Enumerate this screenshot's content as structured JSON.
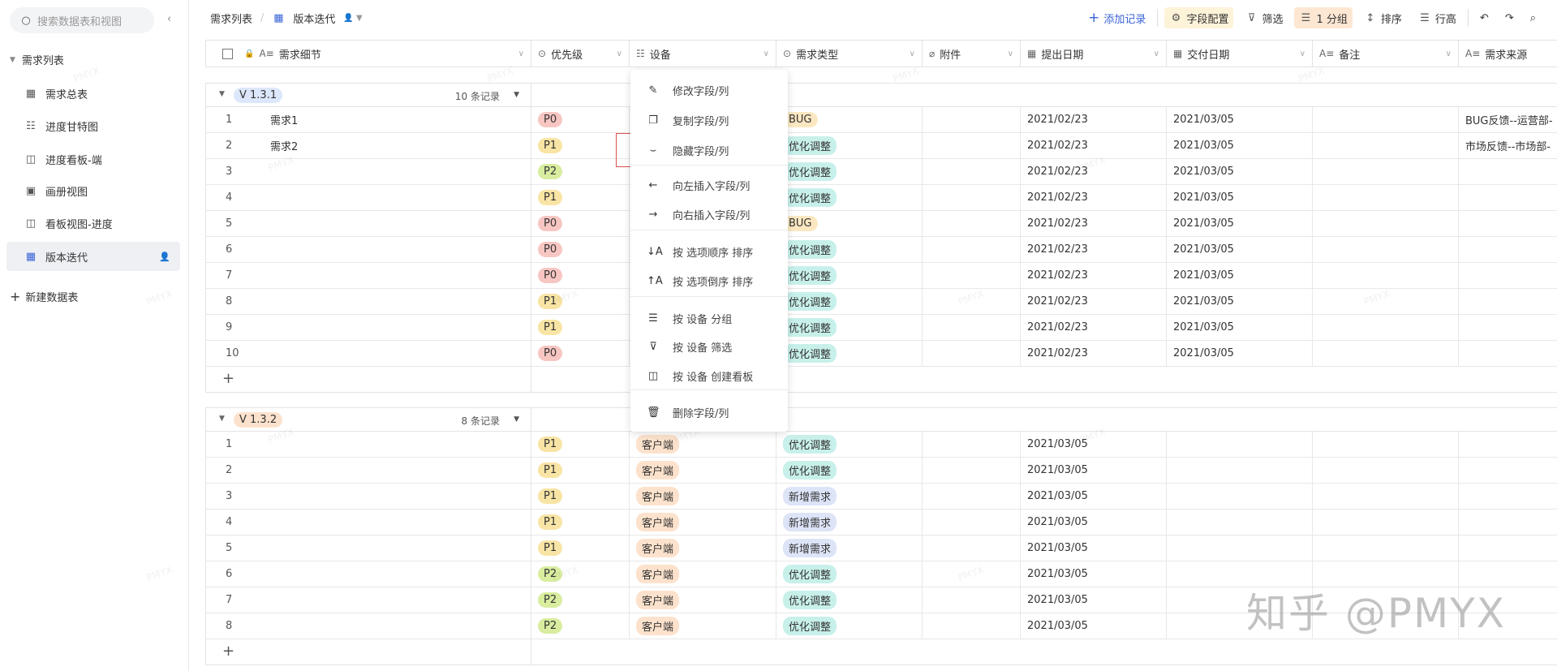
{
  "sidebar": {
    "search_placeholder": "搜索数据表和视图",
    "root": "需求列表",
    "items": [
      {
        "label": "需求总表",
        "icon": "grid"
      },
      {
        "label": "进度甘特图",
        "icon": "gantt"
      },
      {
        "label": "进度看板-端",
        "icon": "kanban"
      },
      {
        "label": "画册视图",
        "icon": "gallery"
      },
      {
        "label": "看板视图-进度",
        "icon": "kanban"
      },
      {
        "label": "版本迭代",
        "icon": "grid",
        "active": true
      }
    ],
    "new_table": "新建数据表"
  },
  "topbar": {
    "crumb_root": "需求列表",
    "crumb_view": "版本迭代",
    "add_record": "添加记录",
    "field_config": "字段配置",
    "filter": "筛选",
    "group": "1 分组",
    "sort": "排序",
    "row_height": "行高"
  },
  "columns": [
    {
      "label": "需求细节",
      "icon": "A≡"
    },
    {
      "label": "优先级",
      "icon": "⊙"
    },
    {
      "label": "设备",
      "icon": "☷"
    },
    {
      "label": "需求类型",
      "icon": "⊙"
    },
    {
      "label": "附件",
      "icon": "⌀"
    },
    {
      "label": "提出日期",
      "icon": "▦"
    },
    {
      "label": "交付日期",
      "icon": "▦"
    },
    {
      "label": "备注",
      "icon": "A≡"
    },
    {
      "label": "需求来源",
      "icon": "A≡"
    }
  ],
  "colors": {
    "P0": "#f7c6c2",
    "P1": "#f8e4a4",
    "P2": "#d8ed9f",
    "BUG": "#fbe8c2",
    "优化调整": "#c8f0eb",
    "新增需求": "#dde4f7",
    "客户端": "#fce2cc",
    "accent": "#3a63d6"
  },
  "groups": [
    {
      "version": "V 1.3.1",
      "count": "10 条记录",
      "rows": [
        {
          "n": "1",
          "detail": "需求1",
          "pri": "P0",
          "device": "",
          "type": "BUG",
          "d1": "2021/02/23",
          "d2": "2021/03/05",
          "src": "BUG反馈--运营部-"
        },
        {
          "n": "2",
          "detail": "需求2",
          "pri": "P1",
          "device": "",
          "type": "优化调整",
          "d1": "2021/02/23",
          "d2": "2021/03/05",
          "src": "市场反馈--市场部-"
        },
        {
          "n": "3",
          "detail": "",
          "pri": "P2",
          "device": "",
          "type": "优化调整",
          "d1": "2021/02/23",
          "d2": "2021/03/05",
          "src": ""
        },
        {
          "n": "4",
          "detail": "",
          "pri": "P1",
          "device": "",
          "type": "优化调整",
          "d1": "2021/02/23",
          "d2": "2021/03/05",
          "src": ""
        },
        {
          "n": "5",
          "detail": "",
          "pri": "P0",
          "device": "",
          "type": "BUG",
          "d1": "2021/02/23",
          "d2": "2021/03/05",
          "src": ""
        },
        {
          "n": "6",
          "detail": "",
          "pri": "P0",
          "device": "",
          "type": "优化调整",
          "d1": "2021/02/23",
          "d2": "2021/03/05",
          "src": ""
        },
        {
          "n": "7",
          "detail": "",
          "pri": "P0",
          "device": "",
          "type": "优化调整",
          "d1": "2021/02/23",
          "d2": "2021/03/05",
          "src": ""
        },
        {
          "n": "8",
          "detail": "",
          "pri": "P1",
          "device": "",
          "type": "优化调整",
          "d1": "2021/02/23",
          "d2": "2021/03/05",
          "src": ""
        },
        {
          "n": "9",
          "detail": "",
          "pri": "P1",
          "device": "",
          "type": "优化调整",
          "d1": "2021/02/23",
          "d2": "2021/03/05",
          "src": ""
        },
        {
          "n": "10",
          "detail": "",
          "pri": "P0",
          "device": "",
          "type": "优化调整",
          "d1": "2021/02/23",
          "d2": "2021/03/05",
          "src": ""
        }
      ]
    },
    {
      "version": "V 1.3.2",
      "count": "8 条记录",
      "rows": [
        {
          "n": "1",
          "detail": "",
          "pri": "P1",
          "device": "客户端",
          "type": "优化调整",
          "d1": "2021/03/05",
          "d2": "",
          "src": ""
        },
        {
          "n": "2",
          "detail": "",
          "pri": "P1",
          "device": "客户端",
          "type": "优化调整",
          "d1": "2021/03/05",
          "d2": "",
          "src": ""
        },
        {
          "n": "3",
          "detail": "",
          "pri": "P1",
          "device": "客户端",
          "type": "新增需求",
          "d1": "2021/03/05",
          "d2": "",
          "src": ""
        },
        {
          "n": "4",
          "detail": "",
          "pri": "P1",
          "device": "客户端",
          "type": "新增需求",
          "d1": "2021/03/05",
          "d2": "",
          "src": ""
        },
        {
          "n": "5",
          "detail": "",
          "pri": "P1",
          "device": "客户端",
          "type": "新增需求",
          "d1": "2021/03/05",
          "d2": "",
          "src": ""
        },
        {
          "n": "6",
          "detail": "",
          "pri": "P2",
          "device": "客户端",
          "type": "优化调整",
          "d1": "2021/03/05",
          "d2": "",
          "src": ""
        },
        {
          "n": "7",
          "detail": "",
          "pri": "P2",
          "device": "客户端",
          "type": "优化调整",
          "d1": "2021/03/05",
          "d2": "",
          "src": ""
        },
        {
          "n": "8",
          "detail": "",
          "pri": "P2",
          "device": "客户端",
          "type": "优化调整",
          "d1": "2021/03/05",
          "d2": "",
          "src": ""
        }
      ]
    }
  ],
  "menu": [
    {
      "label": "修改字段/列",
      "icon": "✎"
    },
    {
      "label": "复制字段/列",
      "icon": "❐"
    },
    {
      "label": "隐藏字段/列",
      "icon": "⌣"
    },
    {
      "label": "向左插入字段/列",
      "icon": "←"
    },
    {
      "label": "向右插入字段/列",
      "icon": "→"
    },
    {
      "label": "按 选项顺序 排序",
      "icon": "↓A"
    },
    {
      "label": "按 选项倒序 排序",
      "icon": "↑A"
    },
    {
      "label": "按 设备 分组",
      "icon": "☰"
    },
    {
      "label": "按 设备 筛选",
      "icon": "⊽"
    },
    {
      "label": "按 设备 创建看板",
      "icon": "◫"
    },
    {
      "label": "删除字段/列",
      "icon": "🗑"
    }
  ],
  "watermark": {
    "small": "PMYX",
    "big": "知乎 @PMYX"
  }
}
